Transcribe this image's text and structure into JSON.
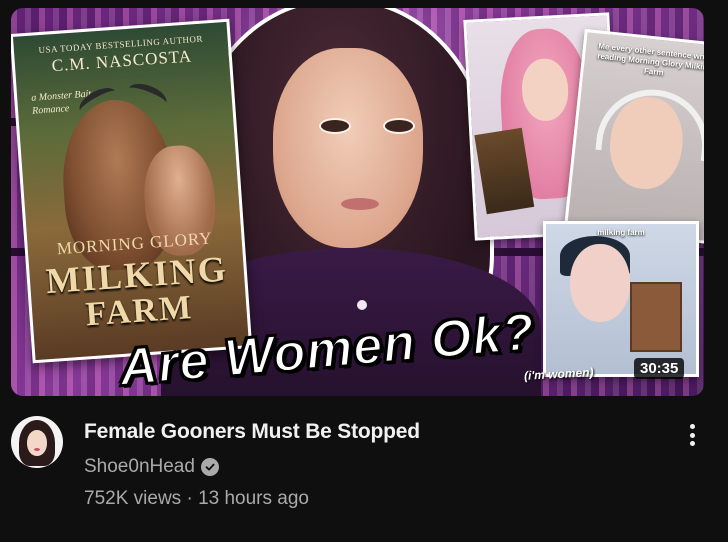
{
  "thumbnail": {
    "book_cover": {
      "bestseller_line": "USA TODAY BESTSELLING AUTHOR",
      "author": "C.M. NASCOSTA",
      "tagline": "a Monster Bait Romance",
      "title_line1": "MORNING GLORY",
      "title_line2": "MILKING",
      "title_line3": "FARM"
    },
    "caption": "Are Women Ok?",
    "clip_caption_top": "Me every other sentence while reading Morning Glory Milking Farm",
    "clip_caption_small": "milking farm",
    "subcaption": "(i'm women)",
    "duration": "30:35"
  },
  "video": {
    "title": "Female Gooners Must Be Stopped",
    "channel": "Shoe0nHead",
    "verified_icon": "check-circle-icon",
    "views": "752K views",
    "separator": "·",
    "age": "13 hours ago"
  },
  "menu_icon": "more-vert-icon",
  "colors": {
    "background": "#0f0f0f",
    "title": "#f1f1f1",
    "secondary": "#aaaaaa",
    "thumb_purple": "#8a3d9a"
  }
}
